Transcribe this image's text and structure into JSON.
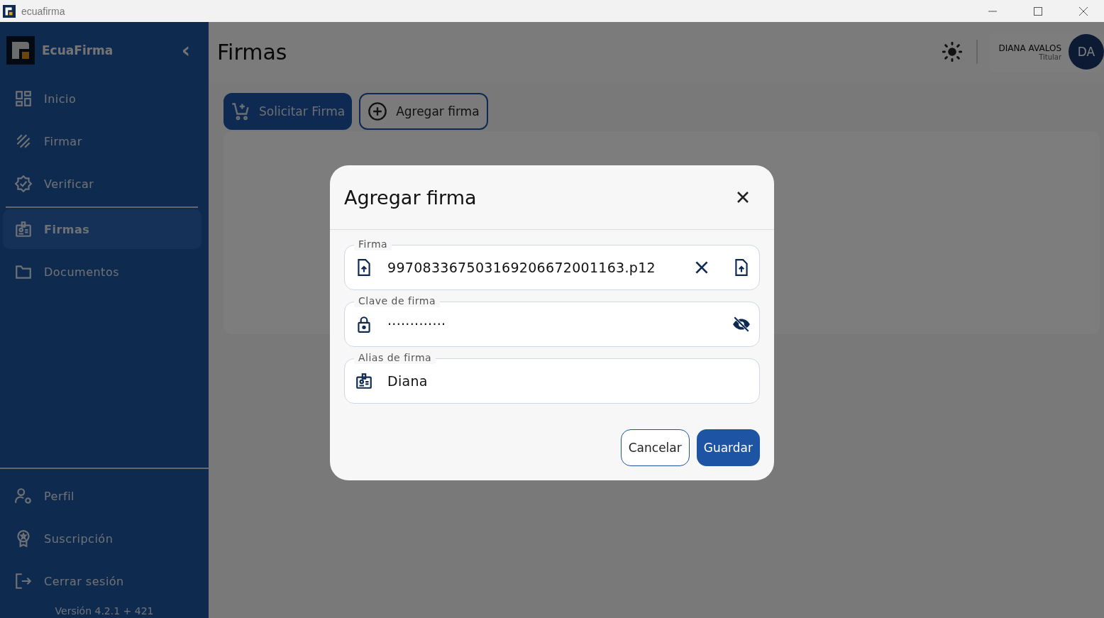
{
  "window": {
    "title": "ecuafirma"
  },
  "sidebar": {
    "brand": "EcuaFirma",
    "collapse_icon": "‹",
    "items": [
      {
        "label": "Inicio",
        "kind": "home",
        "selected": false
      },
      {
        "label": "Firmar",
        "kind": "sign",
        "selected": false
      },
      {
        "label": "Verificar",
        "kind": "verify",
        "selected": false
      },
      {
        "label": "Firmas",
        "kind": "badge",
        "selected": true
      },
      {
        "label": "Documentos",
        "kind": "folder",
        "selected": false
      }
    ],
    "bottom_items": [
      {
        "label": "Perfil",
        "kind": "profile"
      },
      {
        "label": "Suscripción",
        "kind": "award"
      },
      {
        "label": "Cerrar sesión",
        "kind": "logout"
      }
    ],
    "version": "Versión 4.2.1 + 421"
  },
  "header": {
    "title": "Firmas",
    "user_name": "DIANA AVALOS",
    "user_role": "Titular",
    "initials": "DA"
  },
  "toolbar": [
    {
      "label": "Solicitar Firma",
      "kind": "primary"
    },
    {
      "label": "Agregar firma",
      "kind": "outline"
    }
  ],
  "dialog": {
    "title": "Agregar firma",
    "fields": [
      {
        "label": "Firma",
        "value": "997083367503169206672001163.p12",
        "kind": "file"
      },
      {
        "label": "Clave de firma",
        "value": "·············",
        "kind": "password"
      },
      {
        "label": "Alias de firma",
        "value": "Diana",
        "kind": "text"
      }
    ],
    "buttons": [
      {
        "label": "Cancelar",
        "kind": "outline"
      },
      {
        "label": "Guardar",
        "kind": "primary"
      }
    ]
  }
}
